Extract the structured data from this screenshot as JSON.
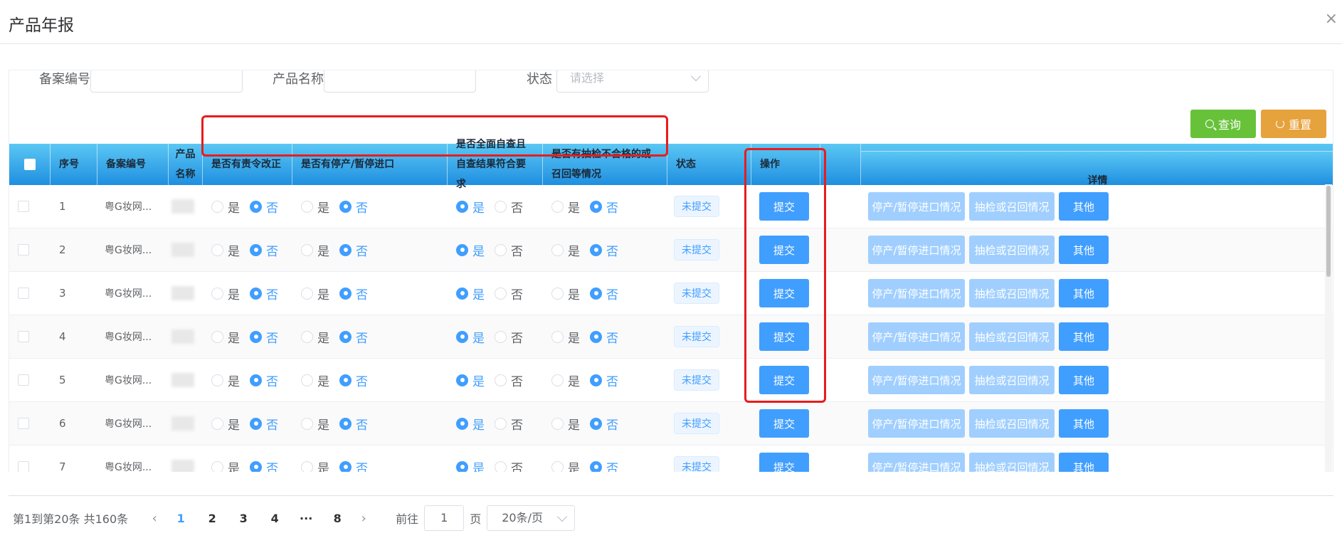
{
  "dialog": {
    "title": "产品年报",
    "close": "×"
  },
  "filters": {
    "record_no_label": "备案编号",
    "product_name_label": "产品名称",
    "status_label": "状态",
    "status_placeholder": "请选择",
    "query_label": "查询",
    "reset_label": "重置"
  },
  "table": {
    "headers": {
      "seq": "序号",
      "record_no": "备案编号",
      "product_name": "产品名称",
      "q1": "是否有责令改正",
      "q2": "是否有停产/暂停进口",
      "q3": "是否全面自查且自查结果符合要求",
      "q4": "是否有抽检不合格的或召回等情况",
      "status": "状态",
      "action": "操作",
      "detail": "详情"
    },
    "yes": "是",
    "no": "否",
    "rows": [
      {
        "seq": "1",
        "record_no": "粤G妆网...",
        "status": "未提交"
      },
      {
        "seq": "2",
        "record_no": "粤G妆网...",
        "status": "未提交"
      },
      {
        "seq": "3",
        "record_no": "粤G妆网...",
        "status": "未提交"
      },
      {
        "seq": "4",
        "record_no": "粤G妆网...",
        "status": "未提交"
      },
      {
        "seq": "5",
        "record_no": "粤G妆网...",
        "status": "未提交"
      },
      {
        "seq": "6",
        "record_no": "粤G妆网...",
        "status": "未提交"
      },
      {
        "seq": "7",
        "record_no": "粤G妆网...",
        "status": "未提交"
      }
    ],
    "submit_label": "提交",
    "detail_buttons": [
      "停产/暂停进口情况",
      "抽检或召回情况",
      "其他"
    ]
  },
  "pagination": {
    "summary": "第1到第20条 共160条",
    "pages": [
      "1",
      "2",
      "3",
      "4",
      "···",
      "8"
    ],
    "current_page": "1",
    "goto_prefix": "前往",
    "goto_value": "1",
    "goto_suffix": "页",
    "page_size": "20条/页"
  },
  "colors": {
    "primary": "#409eff",
    "success": "#67c23a",
    "warning": "#e6a23c",
    "highlight": "#e81c1c"
  }
}
